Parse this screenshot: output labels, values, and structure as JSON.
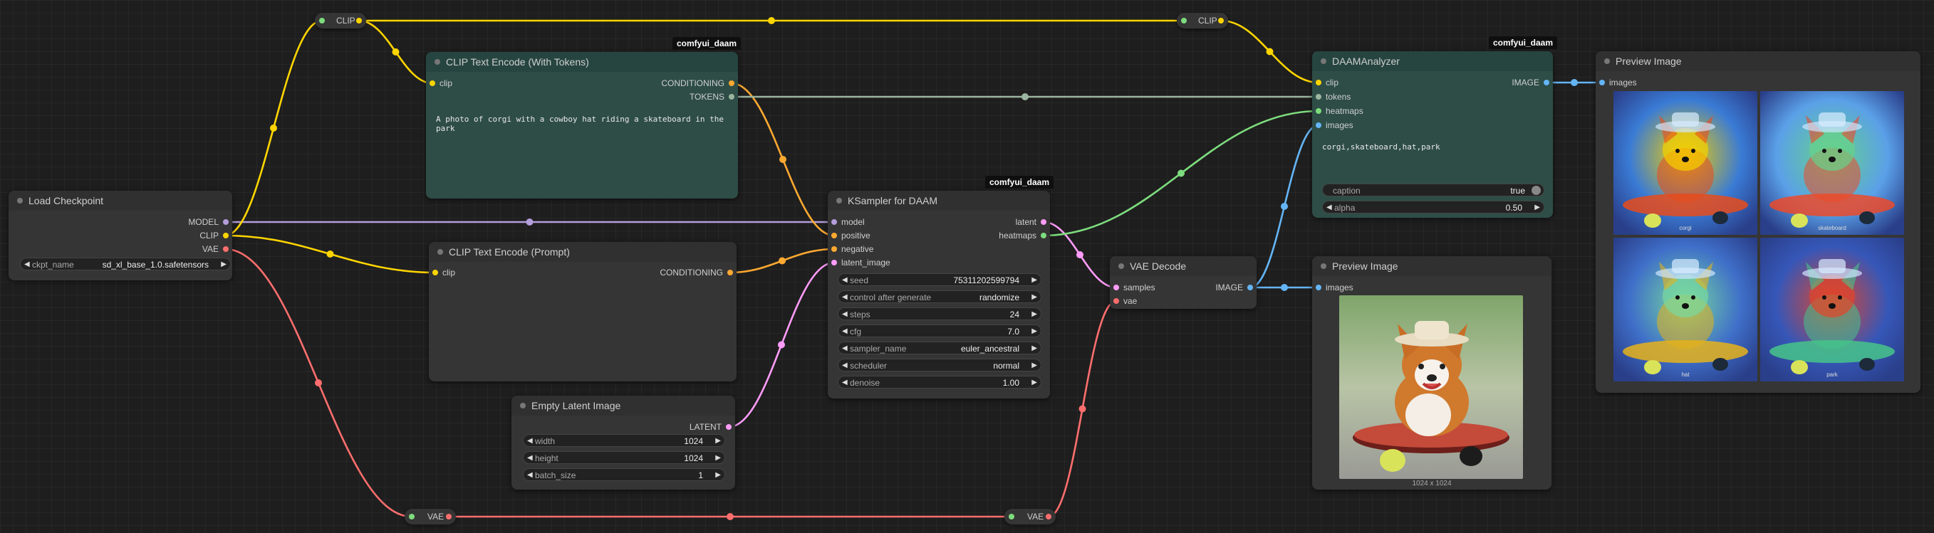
{
  "colors": {
    "model": "#b39ddb",
    "clip": "#ffd500",
    "vae": "#ff6e6e",
    "conditioning": "#ffa931",
    "latent": "#ff9cf9",
    "image": "#64b5f6",
    "tokens": "#9cb5a0",
    "heatmaps": "#7ddc7d"
  },
  "reroutes": {
    "clip_top_left": "CLIP",
    "clip_top_right": "CLIP",
    "vae_bottom_left": "VAE",
    "vae_bottom_right": "VAE"
  },
  "load_checkpoint": {
    "title": "Load Checkpoint",
    "outputs": [
      "MODEL",
      "CLIP",
      "VAE"
    ],
    "ckpt_label": "ckpt_name",
    "ckpt_value": "sd_xl_base_1.0.safetensors"
  },
  "clip_tokens": {
    "badge": "comfyui_daam",
    "title": "CLIP Text Encode (With Tokens)",
    "input": "clip",
    "outputs": [
      "CONDITIONING",
      "TOKENS"
    ],
    "text": "A photo of corgi with a cowboy hat riding a skateboard in the park"
  },
  "clip_prompt": {
    "title": "CLIP Text Encode (Prompt)",
    "input": "clip",
    "output": "CONDITIONING"
  },
  "empty_latent": {
    "title": "Empty Latent Image",
    "output": "LATENT",
    "widgets": [
      {
        "label": "width",
        "value": "1024"
      },
      {
        "label": "height",
        "value": "1024"
      },
      {
        "label": "batch_size",
        "value": "1"
      }
    ]
  },
  "ksampler": {
    "badge": "comfyui_daam",
    "title": "KSampler for DAAM",
    "inputs": [
      "model",
      "positive",
      "negative",
      "latent_image"
    ],
    "outputs": [
      "latent",
      "heatmaps"
    ],
    "widgets": [
      {
        "label": "seed",
        "value": "753112025997 94"
      },
      {
        "label": "control after generate",
        "value": "randomize"
      },
      {
        "label": "steps",
        "value": "24"
      },
      {
        "label": "cfg",
        "value": "7.0"
      },
      {
        "label": "sampler_name",
        "value": "euler_ancestral"
      },
      {
        "label": "scheduler",
        "value": "normal"
      },
      {
        "label": "denoise",
        "value": "1.00"
      }
    ]
  },
  "vae_decode": {
    "title": "VAE Decode",
    "inputs": [
      "samples",
      "vae"
    ],
    "output": "IMAGE"
  },
  "daam": {
    "badge": "comfyui_daam",
    "title": "DAAMAnalyzer",
    "inputs": [
      "clip",
      "tokens",
      "heatmaps",
      "images"
    ],
    "output": "IMAGE",
    "text": "corgi,skateboard,hat,park",
    "caption_label": "caption",
    "caption_value": "true",
    "alpha_label": "alpha",
    "alpha_value": "0.50"
  },
  "preview_small": {
    "title": "Preview Image",
    "input": "images",
    "caption": "1024 x 1024"
  },
  "preview_grid": {
    "title": "Preview Image",
    "input": "images",
    "labels": [
      "corgi",
      "skateboard",
      "hat",
      "park"
    ]
  }
}
